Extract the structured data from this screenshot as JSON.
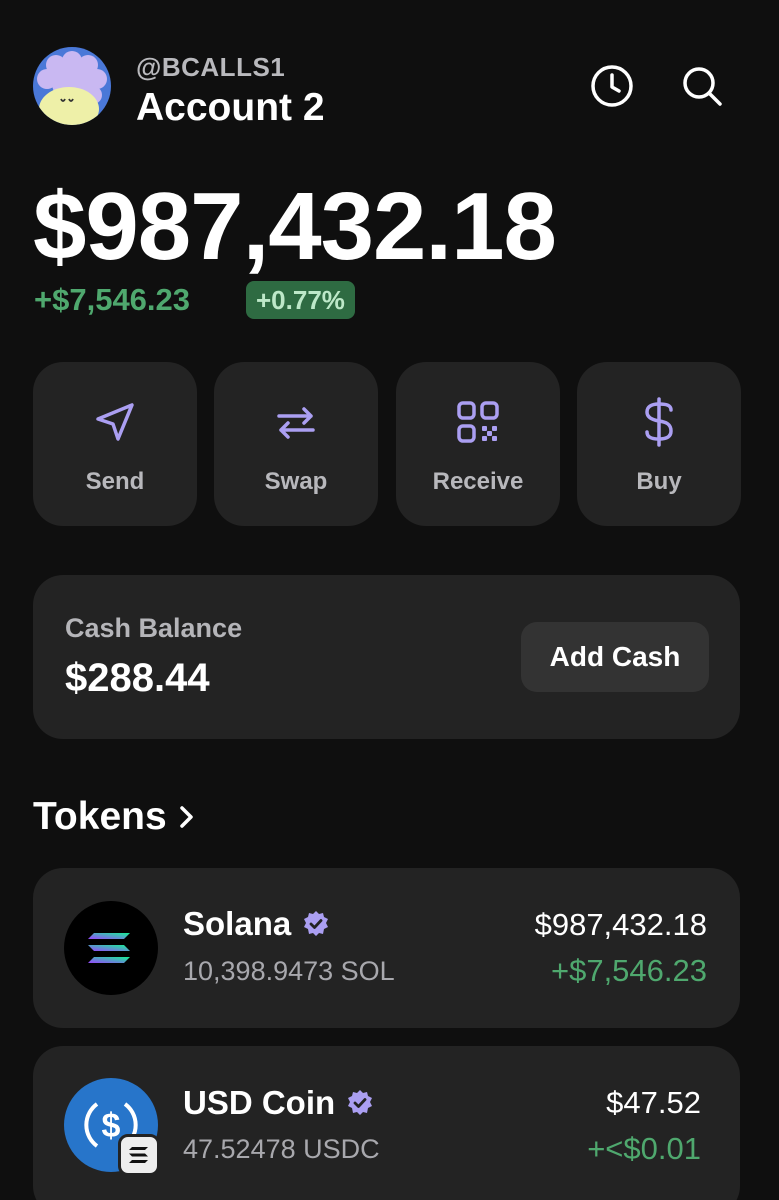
{
  "header": {
    "handle": "@BCALLS1",
    "account_name": "Account 2",
    "icons": [
      "history-icon",
      "search-icon"
    ]
  },
  "balance": {
    "total": "$987,432.18",
    "change_amount": "+$7,546.23",
    "change_percent": "+0.77%"
  },
  "actions": [
    {
      "label": "Send",
      "icon": "send-icon"
    },
    {
      "label": "Swap",
      "icon": "swap-icon"
    },
    {
      "label": "Receive",
      "icon": "qr-code-icon"
    },
    {
      "label": "Buy",
      "icon": "dollar-icon"
    }
  ],
  "cash": {
    "label": "Cash Balance",
    "value": "$288.44",
    "button_label": "Add Cash"
  },
  "tokens": {
    "title": "Tokens",
    "items": [
      {
        "name": "Solana",
        "quantity": "10,398.9473 SOL",
        "value": "$987,432.18",
        "change": "+$7,546.23",
        "verified": true
      },
      {
        "name": "USD Coin",
        "quantity": "47.52478 USDC",
        "value": "$47.52",
        "change": "+<$0.01",
        "verified": true
      }
    ]
  },
  "colors": {
    "background": "#0f0f0f",
    "card": "#232323",
    "accent_purple": "#ab9ff2",
    "positive_green": "#4fa86e"
  }
}
